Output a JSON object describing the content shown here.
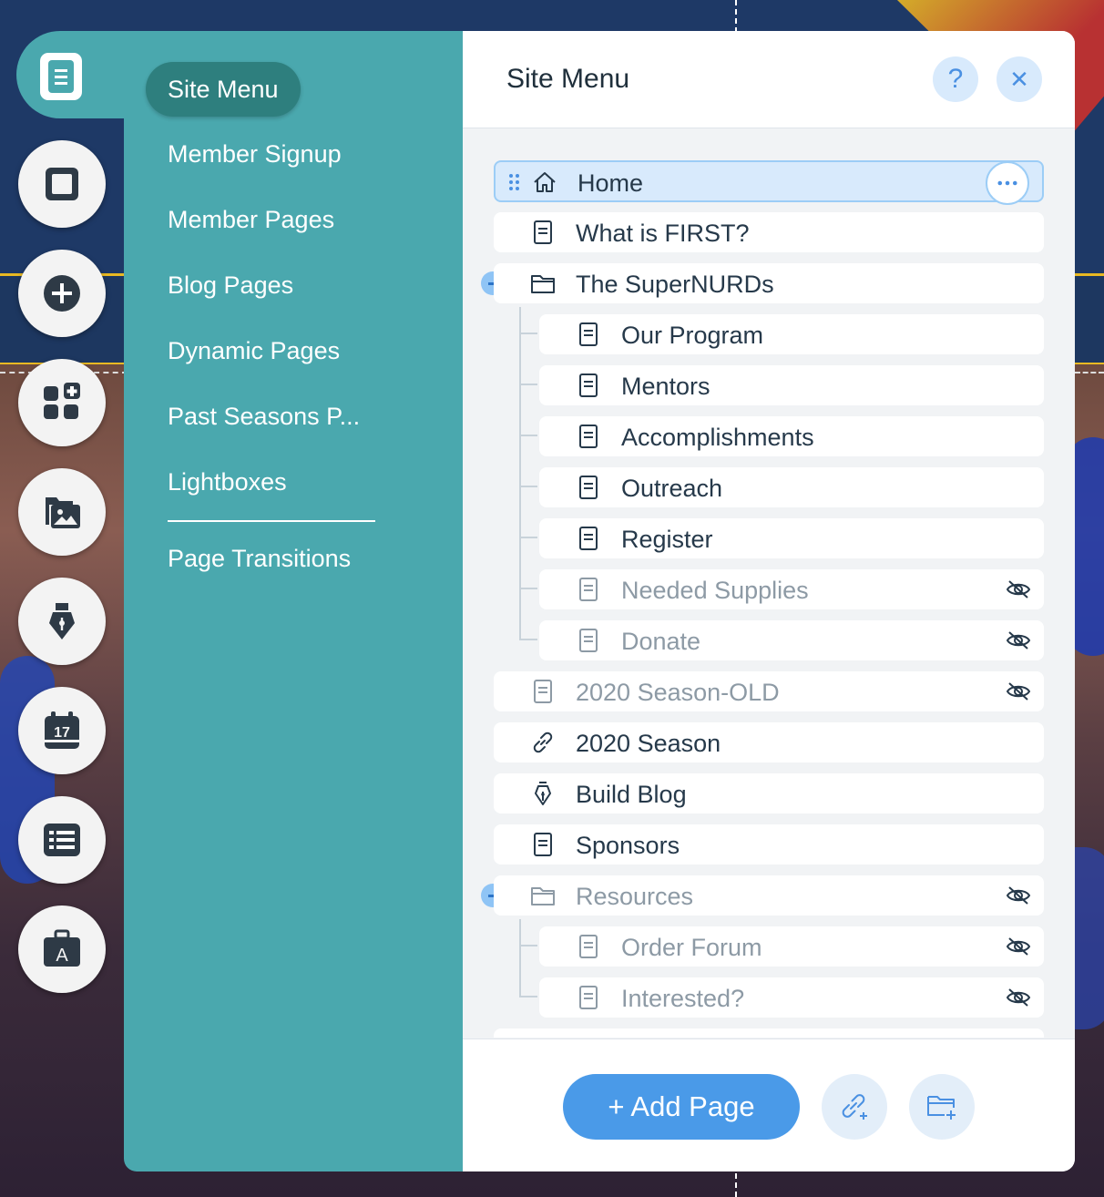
{
  "side_menu": {
    "items": [
      {
        "label": "Site Menu",
        "active": true
      },
      {
        "label": "Member Signup"
      },
      {
        "label": "Member Pages"
      },
      {
        "label": "Blog Pages"
      },
      {
        "label": "Dynamic Pages"
      },
      {
        "label": "Past Seasons P..."
      },
      {
        "label": "Lightboxes"
      },
      {
        "label": "Page Transitions"
      }
    ]
  },
  "toolbar": {
    "tools": [
      "pages-icon",
      "background-icon",
      "add-icon",
      "add-apps-icon",
      "media-icon",
      "blog-pen-icon",
      "events-calendar-icon",
      "list-icon",
      "app-market-icon"
    ],
    "calendar_day": "17",
    "market_letter": "A"
  },
  "panel": {
    "title": "Site Menu",
    "help_symbol": "?",
    "close_symbol": "✕",
    "pages": [
      {
        "label": "Home",
        "icon": "home-icon",
        "selected": true
      },
      {
        "label": "What is FIRST?",
        "icon": "page-icon"
      },
      {
        "label": "The SuperNURDs",
        "icon": "folder-icon",
        "collapsible": true
      },
      {
        "label": "Our Program",
        "icon": "page-icon"
      },
      {
        "label": "Mentors",
        "icon": "page-icon"
      },
      {
        "label": "Accomplishments",
        "icon": "page-icon"
      },
      {
        "label": "Outreach",
        "icon": "page-icon"
      },
      {
        "label": "Register",
        "icon": "page-icon"
      },
      {
        "label": "Needed Supplies",
        "icon": "page-icon",
        "hidden": true
      },
      {
        "label": "Donate",
        "icon": "page-icon",
        "hidden": true
      },
      {
        "label": "2020 Season-OLD",
        "icon": "page-icon",
        "hidden": true
      },
      {
        "label": "2020 Season",
        "icon": "link-icon"
      },
      {
        "label": "Build Blog",
        "icon": "pen-icon"
      },
      {
        "label": "Sponsors",
        "icon": "page-icon"
      },
      {
        "label": "Resources",
        "icon": "folder-icon",
        "collapsible": true,
        "hidden": true
      },
      {
        "label": "Order Forum",
        "icon": "page-icon",
        "hidden": true
      },
      {
        "label": "Interested?",
        "icon": "page-icon",
        "hidden": true
      }
    ],
    "add_page_label": "+ Add Page"
  },
  "colors": {
    "teal": "#4aa8ae",
    "teal_active": "#2e7f7e",
    "accent_blue": "#4a9ae8",
    "selected_row": "#d8eafc"
  }
}
